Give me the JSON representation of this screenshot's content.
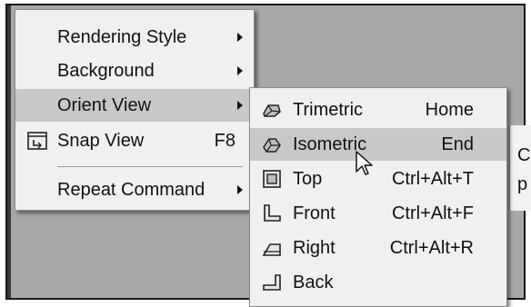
{
  "context_menu": {
    "items": [
      {
        "label": "Rendering Style"
      },
      {
        "label": "Background"
      },
      {
        "label": "Orient View"
      },
      {
        "label": "Snap View",
        "shortcut": "F8"
      },
      {
        "label": "Repeat Command"
      }
    ]
  },
  "orient_submenu": {
    "items": [
      {
        "label": "Trimetric",
        "shortcut": "Home"
      },
      {
        "label": "Isometric",
        "shortcut": "End"
      },
      {
        "label": "Top",
        "shortcut": "Ctrl+Alt+T"
      },
      {
        "label": "Front",
        "shortcut": "Ctrl+Alt+F"
      },
      {
        "label": "Right",
        "shortcut": "Ctrl+Alt+R"
      },
      {
        "label": "Back"
      }
    ]
  },
  "right_panel": {
    "line1": "C",
    "line2": "p"
  },
  "colors": {
    "menu_bg": "#f0f0f0",
    "highlight": "#c8c8c8",
    "backdrop": "#a8a8a8"
  }
}
